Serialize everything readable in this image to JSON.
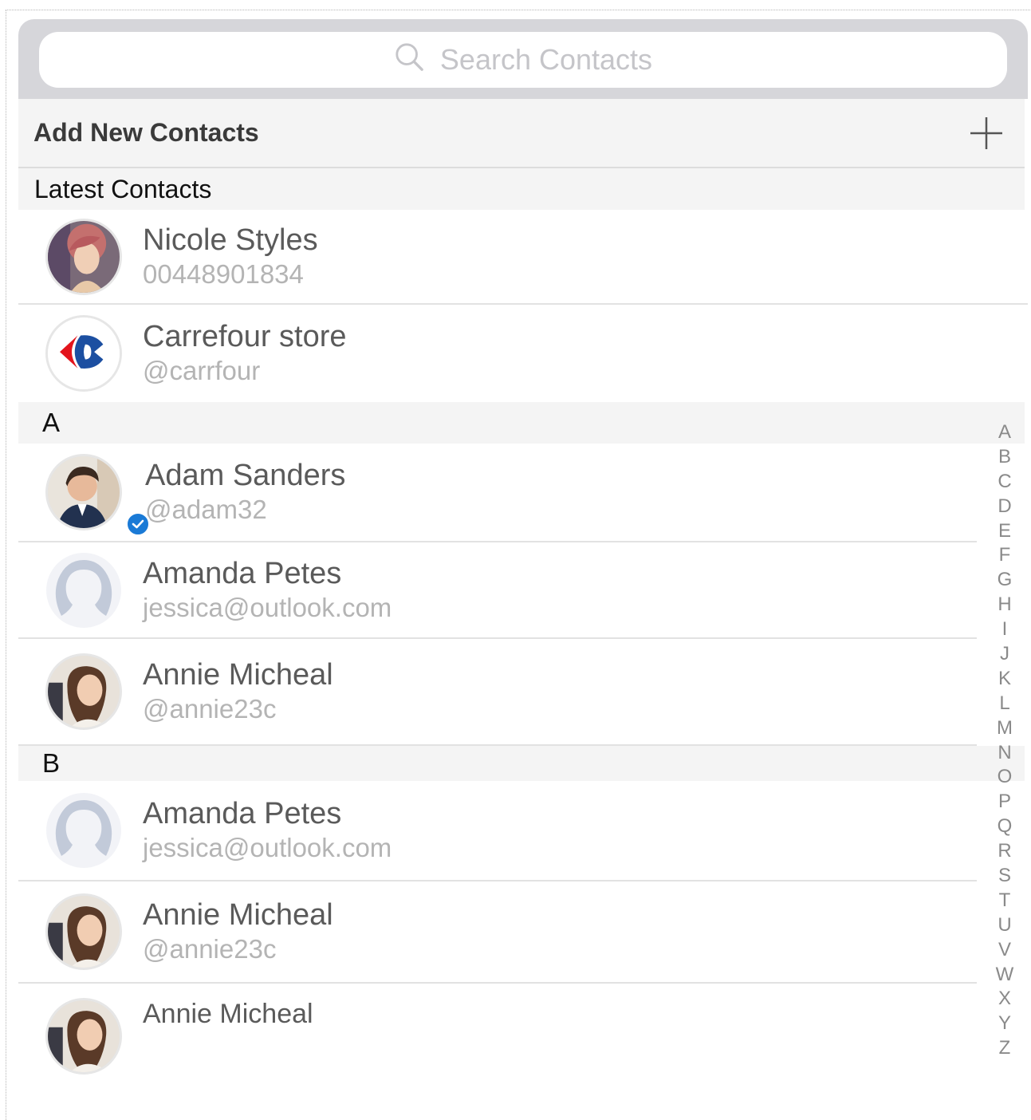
{
  "search": {
    "placeholder": "Search Contacts"
  },
  "add_new": {
    "label": "Add New Contacts"
  },
  "latest_section": {
    "title": "Latest Contacts"
  },
  "latest": [
    {
      "name": "Nicole Styles",
      "sub": "00448901834",
      "avatar": "photo"
    },
    {
      "name": "Carrefour store",
      "sub": "@carrfour",
      "avatar": "carrefour-logo"
    }
  ],
  "sections": [
    {
      "letter": "A",
      "contacts": [
        {
          "name": "Adam Sanders",
          "sub": "@adam32",
          "avatar": "photo",
          "verified": true
        },
        {
          "name": "Amanda Petes",
          "sub": "jessica@outlook.com",
          "avatar": "placeholder"
        },
        {
          "name": "Annie Micheal",
          "sub": "@annie23c",
          "avatar": "photo"
        }
      ]
    },
    {
      "letter": "B",
      "contacts": [
        {
          "name": "Amanda Petes",
          "sub": "jessica@outlook.com",
          "avatar": "placeholder"
        },
        {
          "name": "Annie Micheal",
          "sub": "@annie23c",
          "avatar": "photo"
        },
        {
          "name": "Annie Micheal",
          "sub": "",
          "avatar": "photo"
        }
      ]
    }
  ],
  "alphabet_index": [
    "A",
    "B",
    "C",
    "D",
    "E",
    "F",
    "G",
    "H",
    "I",
    "J",
    "K",
    "L",
    "M",
    "N",
    "O",
    "P",
    "Q",
    "R",
    "S",
    "T",
    "U",
    "V",
    "W",
    "X",
    "Y",
    "Z"
  ],
  "colors": {
    "accent": "#1a7ad6",
    "search_bg": "#d6d6da",
    "section_bg": "#f4f4f4"
  }
}
